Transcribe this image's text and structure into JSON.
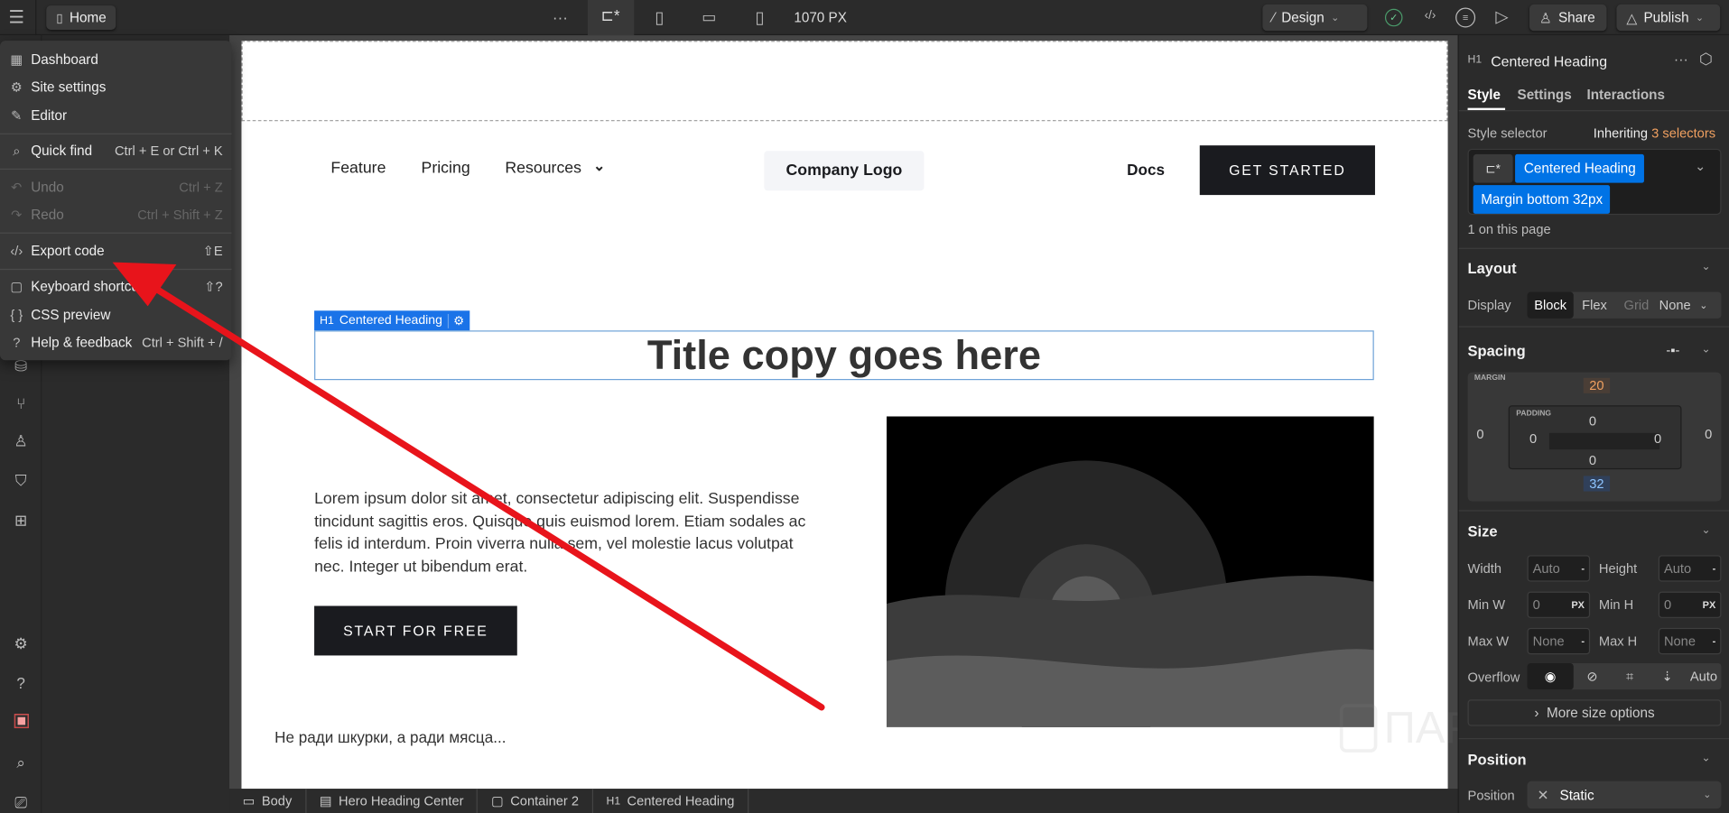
{
  "topbar": {
    "page_name": "Home",
    "more": "···",
    "breakpoint_width": "1070 PX",
    "design_label": "Design",
    "share_label": "Share",
    "publish_label": "Publish"
  },
  "menu": {
    "items": [
      {
        "icon": "grid-icon",
        "glyph": "▦",
        "label": "Dashboard",
        "shortcut": ""
      },
      {
        "icon": "gear-icon",
        "glyph": "⚙",
        "label": "Site settings",
        "shortcut": ""
      },
      {
        "icon": "pencil-icon",
        "glyph": "✎",
        "label": "Editor",
        "shortcut": ""
      },
      {
        "icon": "search-icon",
        "glyph": "⌕",
        "label": "Quick find",
        "shortcut": "Ctrl + E or Ctrl + K"
      },
      {
        "icon": "undo-icon",
        "glyph": "↶",
        "label": "Undo",
        "shortcut": "Ctrl + Z"
      },
      {
        "icon": "redo-icon",
        "glyph": "↷",
        "label": "Redo",
        "shortcut": "Ctrl + Shift + Z"
      },
      {
        "icon": "code-icon",
        "glyph": "‹/›",
        "label": "Export code",
        "shortcut": "⇧E"
      },
      {
        "icon": "keyboard-icon",
        "glyph": "▢",
        "label": "Keyboard shortcuts",
        "shortcut": "⇧?"
      },
      {
        "icon": "braces-icon",
        "glyph": "{ }",
        "label": "CSS preview",
        "shortcut": ""
      },
      {
        "icon": "help-icon",
        "glyph": "?",
        "label": "Help & feedback",
        "shortcut": "Ctrl + Shift + /"
      }
    ]
  },
  "canvas": {
    "nav": {
      "links": [
        "Feature",
        "Pricing",
        "Resources"
      ],
      "logo": "Company Logo",
      "docs": "Docs",
      "cta": "GET STARTED"
    },
    "selected_tag": {
      "type": "H1",
      "label": "Centered Heading"
    },
    "title": "Title copy goes here",
    "paragraph": "Lorem ipsum dolor sit amet, consectetur adipiscing elit. Suspendisse tincidunt sagittis eros. Quisque quis euismod lorem. Etiam sodales ac felis id interdum. Proin viverra nulla sem, vel molestie lacus volutpat nec. Integer ut bibendum erat.",
    "button": "START FOR FREE",
    "caption": "Не ради шкурки, а ради мясца...",
    "watermark": "ПАРТНЕРКИН"
  },
  "breadcrumb": [
    {
      "icon": "body-icon",
      "label": "Body"
    },
    {
      "icon": "section-icon",
      "label": "Hero Heading Center"
    },
    {
      "icon": "container-icon",
      "label": "Container 2"
    },
    {
      "icon": "h1-icon",
      "label": "Centered Heading",
      "prefix": "H1"
    }
  ],
  "panel": {
    "element_type": "H1",
    "element_name": "Centered Heading",
    "tabs": [
      "Style",
      "Settings",
      "Interactions"
    ],
    "style_selector_label": "Style selector",
    "inheriting": "Inheriting",
    "inheriting_count": "3 selectors",
    "selectors": [
      "Centered Heading",
      "Margin bottom 32px"
    ],
    "on_page": "1 on this page",
    "layout": {
      "title": "Layout",
      "display_label": "Display",
      "options": [
        "Block",
        "Flex",
        "Grid",
        "None"
      ],
      "selected": "Block"
    },
    "spacing": {
      "title": "Spacing",
      "margin_label": "MARGIN",
      "padding_label": "PADDING",
      "margin": {
        "top": "20",
        "right": "0",
        "bottom": "32",
        "left": "0"
      },
      "padding": {
        "top": "0",
        "right": "0",
        "bottom": "0",
        "left": "0"
      }
    },
    "size": {
      "title": "Size",
      "width_label": "Width",
      "width": "Auto",
      "height_label": "Height",
      "height": "Auto",
      "minw_label": "Min W",
      "minw": "0",
      "minh_label": "Min H",
      "minh": "0",
      "unit": "PX",
      "maxw_label": "Max W",
      "maxw": "None",
      "maxh_label": "Max H",
      "maxh": "None",
      "dash": "-",
      "overflow_label": "Overflow",
      "overflow_auto": "Auto",
      "more": "More size options"
    },
    "position": {
      "title": "Position",
      "label": "Position",
      "value": "Static"
    }
  },
  "colors": {
    "accent": "#0073e6",
    "orange": "#f0a060",
    "annotation_arrow": "#e8141b"
  }
}
